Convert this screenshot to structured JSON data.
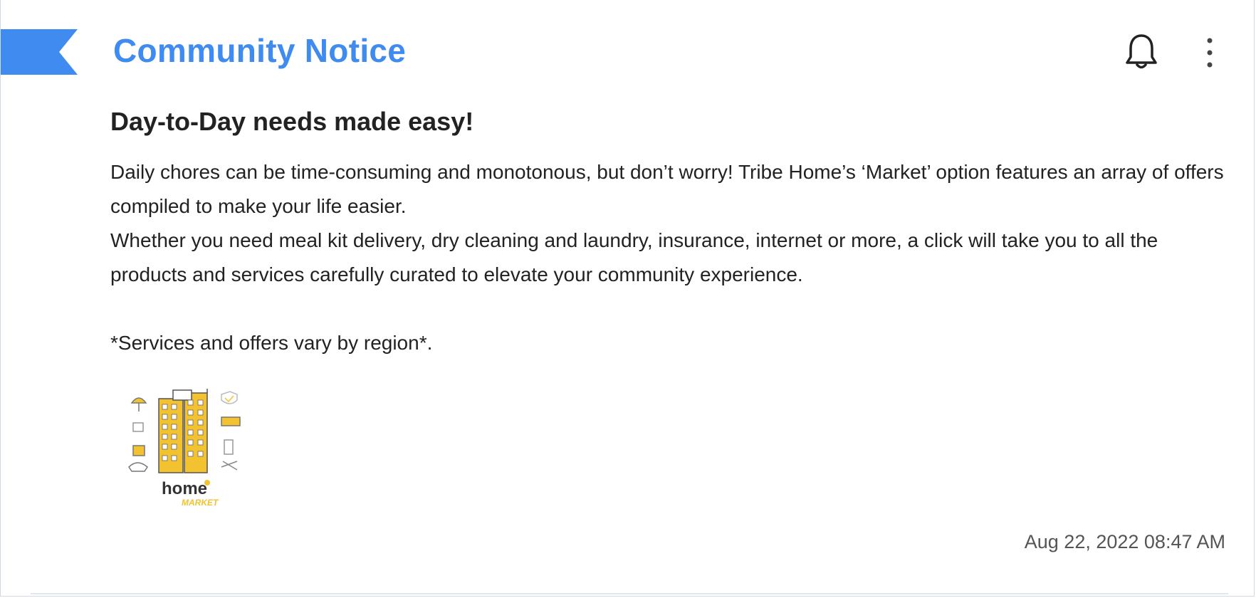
{
  "notice": {
    "title": "Community Notice",
    "headline": "Day-to-Day needs made easy!",
    "paragraph_1": "Daily chores can be time-consuming and monotonous, but don’t worry! Tribe Home’s ‘Market’ option features an array of offers compiled to make your life easier.",
    "paragraph_2": "Whether you need meal kit delivery, dry cleaning and laundry, insurance, internet or more, a click will take you to all the products and services carefully curated to elevate your community experience.",
    "disclaimer": "*Services and offers vary by region*.",
    "timestamp": "Aug 22, 2022 08:47 AM"
  },
  "logo": {
    "word": "home",
    "subword": "MARKET"
  },
  "icons": {
    "ribbon": "bookmark-ribbon-icon",
    "bell": "bell-icon",
    "menu": "more-vertical-icon"
  },
  "colors": {
    "accent": "#3f8bf0",
    "text": "#222222",
    "muted": "#555555",
    "logo_yellow": "#f2c230"
  }
}
